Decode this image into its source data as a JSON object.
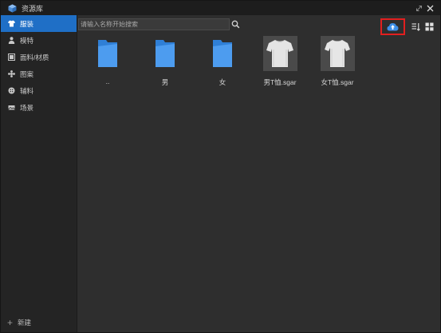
{
  "window": {
    "title": "资源库"
  },
  "sidebar": {
    "items": [
      {
        "label": "服装",
        "icon": "shirt-icon",
        "active": true
      },
      {
        "label": "模特",
        "icon": "person-icon",
        "active": false
      },
      {
        "label": "面料/材质",
        "icon": "fabric-icon",
        "active": false
      },
      {
        "label": "图案",
        "icon": "pattern-icon",
        "active": false
      },
      {
        "label": "辅料",
        "icon": "button-icon",
        "active": false
      },
      {
        "label": "场景",
        "icon": "scene-icon",
        "active": false
      }
    ],
    "new_label": "新建"
  },
  "search": {
    "placeholder": "请输入名称开始搜索",
    "value": ""
  },
  "toolbar": {
    "cloud_icon": "cloud-upload-icon",
    "sort_icon": "sort-icon",
    "grid_icon": "grid-view-icon",
    "highlight_color": "#e21f1f"
  },
  "files": [
    {
      "name": "..",
      "type": "folder"
    },
    {
      "name": "男",
      "type": "folder"
    },
    {
      "name": "女",
      "type": "folder"
    },
    {
      "name": "男T恤.sgar",
      "type": "garment"
    },
    {
      "name": "女T恤.sgar",
      "type": "garment"
    }
  ],
  "colors": {
    "accent": "#1f6fc6",
    "folder": "#3d8fe8",
    "background": "#2e2e2e"
  }
}
